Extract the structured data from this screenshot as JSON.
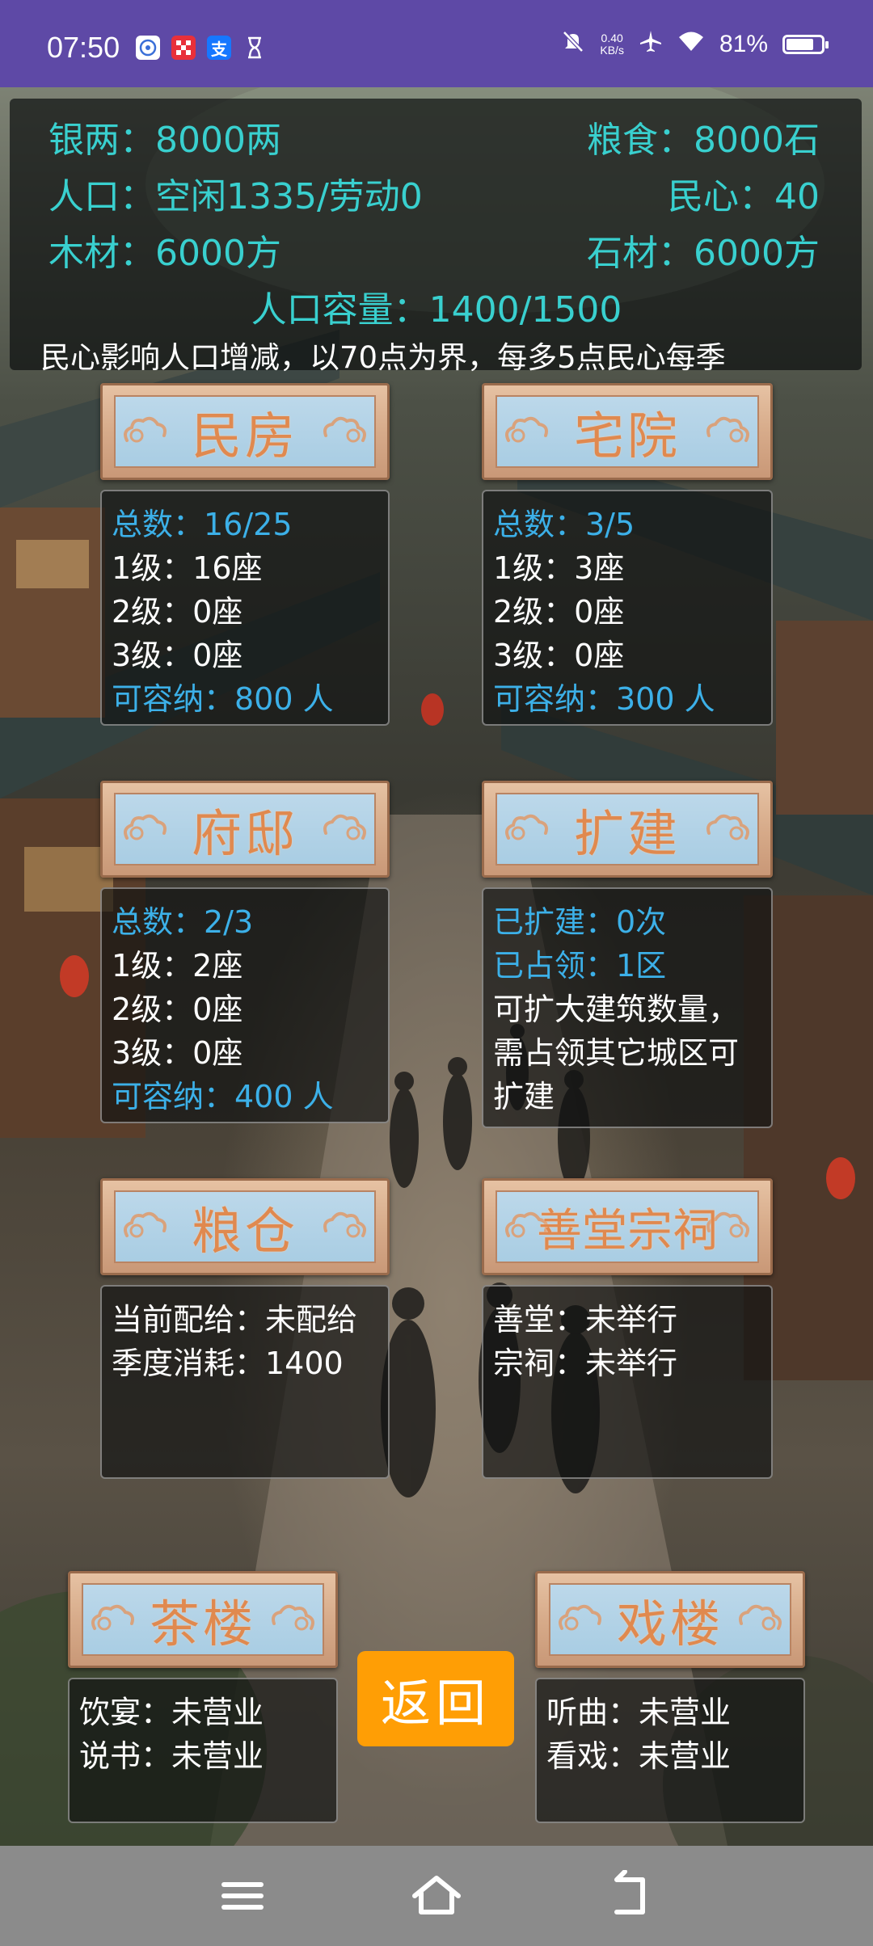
{
  "status_bar": {
    "time": "07:50",
    "speed": "0.40\nKB/s",
    "battery": "81%",
    "battery_level": 0.81,
    "icons": [
      "app-icon-1",
      "app-icon-2",
      "alipay-icon",
      "hourglass-icon",
      "mute-icon",
      "airplane-icon",
      "wifi-icon",
      "battery-icon"
    ]
  },
  "resources": {
    "silver": "银两：8000两",
    "food": "粮食：8000石",
    "population": "人口：空闲1335/劳动0",
    "morale": "民心：40",
    "wood": "木材：6000方",
    "stone": "石材：6000方",
    "capacity": "人口容量：1400/1500",
    "notice": "民心影响人口增减，以70点为界，每多5点民心每季"
  },
  "buildings": {
    "minfang": {
      "title": "民房",
      "lines": [
        "总数：16/25",
        "1级：16座",
        "2级：0座",
        "3级：0座",
        "可容纳：800 人"
      ]
    },
    "zhaiyuan": {
      "title": "宅院",
      "lines": [
        "总数：3/5",
        "1级：3座",
        "2级：0座",
        "3级：0座",
        "可容纳：300 人"
      ]
    },
    "fudi": {
      "title": "府邸",
      "lines": [
        "总数：2/3",
        "1级：2座",
        "2级：0座",
        "3级：0座",
        "可容纳：400 人"
      ]
    },
    "kuojian": {
      "title": "扩建",
      "lines": [
        "已扩建：0次",
        "已占领：1区",
        "可扩大建筑数量，需占领其它城区可扩建"
      ]
    },
    "liangcang": {
      "title": "粮仓",
      "lines": [
        "当前配给：未配给",
        "季度消耗：1400"
      ]
    },
    "shantang": {
      "title": "善堂宗祠",
      "lines": [
        "善堂：未举行",
        "宗祠：未举行"
      ]
    },
    "chalou": {
      "title": "茶楼",
      "lines": [
        "饮宴：未营业",
        "说书：未营业"
      ]
    },
    "xilou": {
      "title": "戏楼",
      "lines": [
        "听曲：未营业",
        "看戏：未营业"
      ]
    }
  },
  "back_button": "返回",
  "colors": {
    "status_bar": "#5e49a6",
    "resource_text": "#39d0cf",
    "highlight_text": "#3cb0e8",
    "plaque_title": "#e0894f",
    "back_button": "#ff9e05",
    "nav_bar": "#8b8b8b"
  }
}
